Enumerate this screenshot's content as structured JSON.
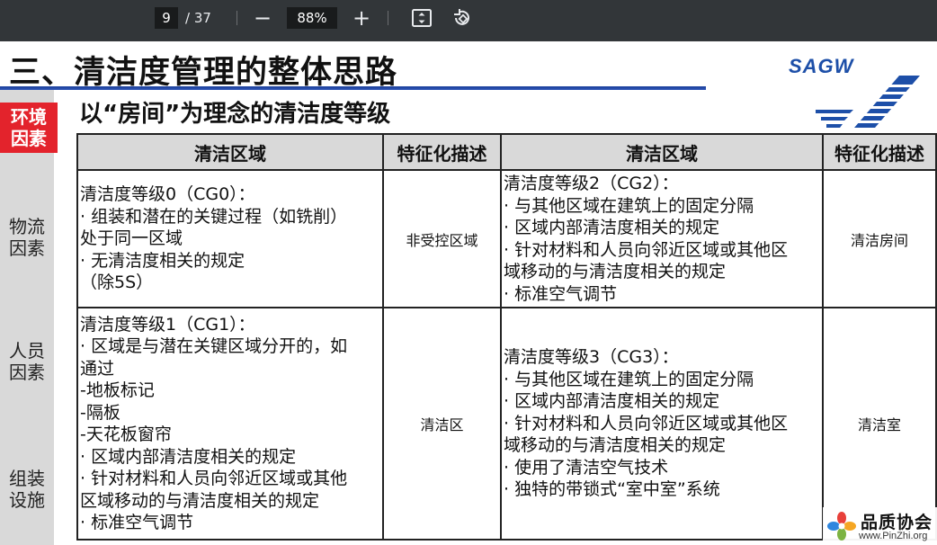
{
  "toolbar": {
    "page_current": "9",
    "page_total": "/ 37",
    "zoom_out_symbol": "−",
    "zoom_value": "88%",
    "zoom_in_symbol": "+",
    "fit_icon": "fit-page-icon",
    "rotate_icon": "rotate-icon"
  },
  "slide": {
    "title": "三、清洁度管理的整体思路",
    "subtitle": "以“房间”为理念的清洁度等级",
    "logo_text": "SAGW",
    "accent_color": "#1d4fa8",
    "side_nav": [
      {
        "line1": "环境",
        "line2": "因素",
        "active": true
      },
      {
        "line1": "物流",
        "line2": "因素",
        "active": false
      },
      {
        "line1": "人员",
        "line2": "因素",
        "active": false
      },
      {
        "line1": "组装",
        "line2": "设施",
        "active": false
      }
    ],
    "table": {
      "headers": [
        "清洁区域",
        "特征化描述",
        "清洁区域",
        "特征化描述"
      ],
      "rows": [
        {
          "left_lines": [
            "清洁度等级0（CG0）：",
            "· 组装和潜在的关键过程（如铣削）",
            "处于同一区域",
            "· 无清洁度相关的规定",
            "（除5S）"
          ],
          "left_char": "非受控区域",
          "right_lines": [
            "清洁度等级2（CG2）：",
            "· 与其他区域在建筑上的固定分隔",
            "· 区域内部清洁度相关的规定",
            "· 针对材料和人员向邻近区域或其他区",
            "域移动的与清洁度相关的规定",
            "· 标准空气调节"
          ],
          "right_char": "清洁房间"
        },
        {
          "left_lines": [
            "清洁度等级1（CG1）：",
            "· 区域是与潜在关键区域分开的，如",
            "通过",
            "-地板标记",
            "-隔板",
            "-天花板窗帘",
            "· 区域内部清洁度相关的规定",
            "· 针对材料和人员向邻近区域或其他",
            "区域移动的与清洁度相关的规定",
            "· 标准空气调节"
          ],
          "left_char": "清洁区",
          "right_lines": [
            "清洁度等级3（CG3）：",
            "· 与其他区域在建筑上的固定分隔",
            "· 区域内部清洁度相关的规定",
            "· 针对材料和人员向邻近区域或其他区",
            "域移动的与清洁度相关的规定",
            "· 使用了清洁空气技术",
            "· 独特的带锁式“室中室”系统"
          ],
          "right_char": "清洁室"
        }
      ]
    },
    "watermark": {
      "name": "品质协会",
      "url": "www.PinZhi.org"
    }
  }
}
